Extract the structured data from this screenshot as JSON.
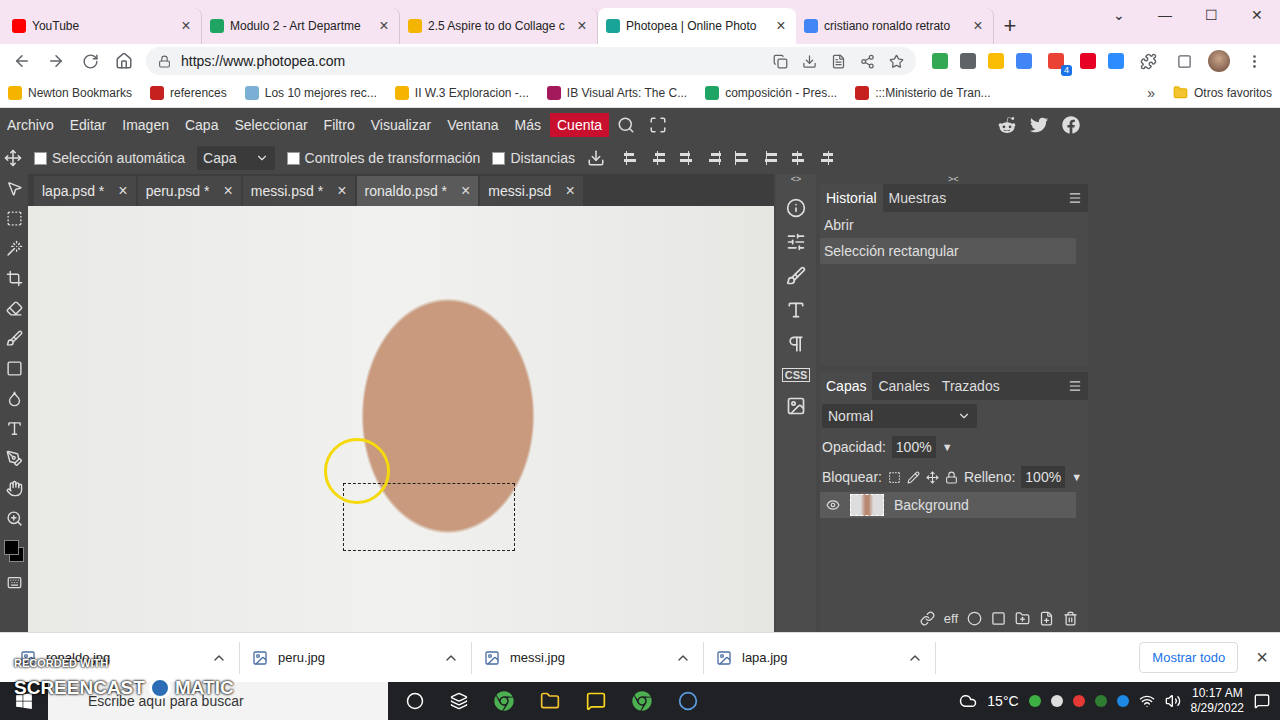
{
  "browser": {
    "tabs": [
      {
        "label": "YouTube",
        "selected": false,
        "color": "#ff0000"
      },
      {
        "label": "Modulo 2 - Art Departme",
        "selected": false,
        "color": "#1fa463"
      },
      {
        "label": "2.5 Aspire to do Collage c",
        "selected": false,
        "color": "#f4b400"
      },
      {
        "label": "Photopea | Online Photo",
        "selected": true,
        "color": "#18a497"
      },
      {
        "label": "cristiano ronaldo retrato",
        "selected": false,
        "color": "#4285f4"
      }
    ],
    "tab_close": "×",
    "new_tab": "+",
    "window_controls": [
      "⌄",
      "—",
      "☐",
      "✕"
    ],
    "url": "https://www.photopea.com",
    "extension_badge": "4",
    "bookmarks": [
      {
        "label": "Newton Bookmarks",
        "color": "#f4b400"
      },
      {
        "label": "references",
        "color": "#c5221f"
      },
      {
        "label": "Los 10 mejores rec...",
        "color": "#7bafd4"
      },
      {
        "label": "II W.3 Exploracion -...",
        "color": "#f4b400"
      },
      {
        "label": "IB Visual Arts: The C...",
        "color": "#a3195b"
      },
      {
        "label": "composición - Pres...",
        "color": "#1fa463"
      },
      {
        "label": ":::Ministerio de Tran...",
        "color": "#c5221f"
      }
    ],
    "bookmarks_more": "»",
    "other_bookmarks": "Otros favoritos"
  },
  "photopea": {
    "menu": [
      {
        "label": "Archivo",
        "highlighted": false
      },
      {
        "label": "Editar",
        "highlighted": false
      },
      {
        "label": "Imagen",
        "highlighted": false
      },
      {
        "label": "Capa",
        "highlighted": false
      },
      {
        "label": "Seleccionar",
        "highlighted": false
      },
      {
        "label": "Filtro",
        "highlighted": false
      },
      {
        "label": "Visualizar",
        "highlighted": false
      },
      {
        "label": "Ventana",
        "highlighted": false
      },
      {
        "label": "Más",
        "highlighted": false
      },
      {
        "label": "Cuenta",
        "highlighted": true
      }
    ],
    "options": {
      "auto_select": {
        "label": "Selección automática",
        "checked": false
      },
      "target": "Capa",
      "transform_controls": {
        "label": "Controles de transformación",
        "checked": false
      },
      "distances": {
        "label": "Distancias",
        "checked": false
      }
    },
    "documents": [
      {
        "label": "lapa.psd *",
        "selected": false
      },
      {
        "label": "peru.psd *",
        "selected": false
      },
      {
        "label": "messi.psd *",
        "selected": false
      },
      {
        "label": "ronaldo.psd *",
        "selected": true
      },
      {
        "label": "messi.psd",
        "selected": false
      }
    ],
    "doc_close": "×",
    "canvas": {
      "selection": true
    },
    "sidebar_toggle": "<>",
    "panel_toggle": "><",
    "css_label": "CSS",
    "history": {
      "tabs": [
        {
          "label": "Historial",
          "selected": true
        },
        {
          "label": "Muestras",
          "selected": false
        }
      ],
      "items": [
        {
          "label": "Abrir",
          "selected": false
        },
        {
          "label": "Selección rectangular",
          "selected": true
        }
      ]
    },
    "layers": {
      "tabs": [
        {
          "label": "Capas",
          "selected": true
        },
        {
          "label": "Canales",
          "selected": false
        },
        {
          "label": "Trazados",
          "selected": false
        }
      ],
      "blend_mode": "Normal",
      "opacity_label": "Opacidad:",
      "opacity": "100%",
      "lock_label": "Bloquear:",
      "fill_label": "Relleno:",
      "fill": "100%",
      "dropdown_glyph": "▼",
      "items": [
        {
          "name": "Background",
          "visible": true,
          "selected": true
        }
      ]
    },
    "effects_label": "eff"
  },
  "downloads": {
    "items": [
      "ronaldo.jpg",
      "peru.jpg",
      "messi.jpg",
      "lapa.jpg"
    ],
    "show_all": "Mostrar todo",
    "close": "×"
  },
  "taskbar": {
    "search": "Escribe aquí para buscar",
    "temperature": "15°C",
    "time": "10:17 AM",
    "date": "8/29/2022"
  },
  "watermark": {
    "top": "RECORDED WITH",
    "left": "SCREENCAST",
    "right": "MATIC"
  }
}
